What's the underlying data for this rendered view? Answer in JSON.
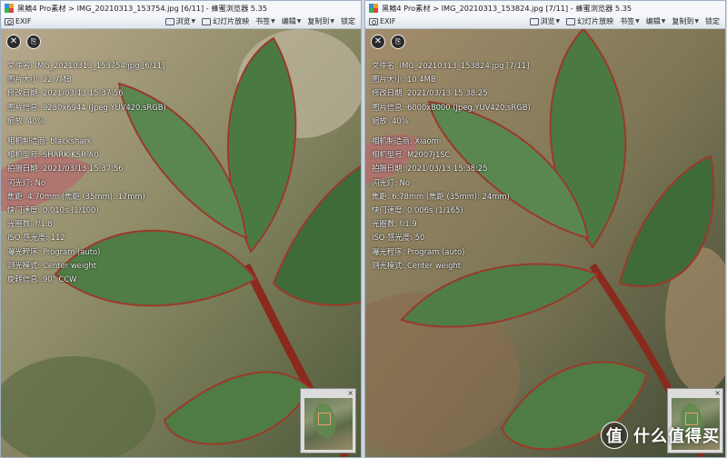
{
  "left": {
    "title": "黑鳍4 Pro素材 > IMG_20210313_153754.jpg [6/11] - 蜂蜜浏览器 5.35",
    "toolbar": {
      "exif": "EXIF",
      "browse": "浏览",
      "slideshow": "幻灯片放映",
      "bookmark": "书签",
      "edit": "编辑",
      "copyto": "复制到",
      "lock": "锁定"
    },
    "exif_group1": [
      "文件名: IMG_20210313_153754.jpg [6/11]",
      "图片大小: 22.7MB",
      "修改日期: 2021/03/13 15:37:56",
      "图片信息: 9280x6944 (Jpeg,YUV420,sRGB)",
      "缩放: 40%"
    ],
    "exif_group2": [
      "相机制造商: blackshark",
      "相机型号: SHARK KSR-A0",
      "拍摄日期: 2021/03/13 15:37:56",
      "闪光灯: No",
      "焦距: 4.70mm (焦距 (35mm): 17mm)",
      "快门速度: 0.010s (1/100)",
      "光圈数: f/1.8",
      "ISO 感光度: 112",
      "曝光程序: Program (auto)",
      "测光模式: Center weight",
      "旋转信息: 90° CCW"
    ],
    "thumb_close": "×"
  },
  "right": {
    "title": "黑鳍4 Pro素材 > IMG_20210313_153824.jpg [7/11] - 蜂蜜浏览器 5.35",
    "toolbar": {
      "exif": "EXIF",
      "browse": "浏览",
      "slideshow": "幻灯片放映",
      "bookmark": "书签",
      "edit": "编辑",
      "copyto": "复制到",
      "lock": "锁定"
    },
    "exif_group1": [
      "文件名: IMG_20210313_153824.jpg [7/11]",
      "图片大小: 10.4MB",
      "修改日期: 2021/03/13 15:38:25",
      "图片信息: 6000x8000 (Jpeg,YUV420,sRGB)",
      "缩放: 40%"
    ],
    "exif_group2": [
      "相机制造商: Xiaomi",
      "相机型号: M2007J1SC",
      "拍摄日期: 2021/03/13 15:38:25",
      "闪光灯: No",
      "焦距: 6.78mm (焦距 (35mm): 24mm)",
      "快门速度: 0.006s (1/165)",
      "光圈数: f/1.9",
      "ISO 感光度: 50",
      "曝光程序: Program (auto)",
      "测光模式: Center weight"
    ],
    "thumb_close": "×"
  },
  "watermark": {
    "badge": "值",
    "text": "什么值得买"
  },
  "colors": {
    "leaf": "#4f7d45",
    "stem": "#8a2a1c",
    "bg_warm": "#a89372",
    "bg_dark": "#3f4a33"
  }
}
